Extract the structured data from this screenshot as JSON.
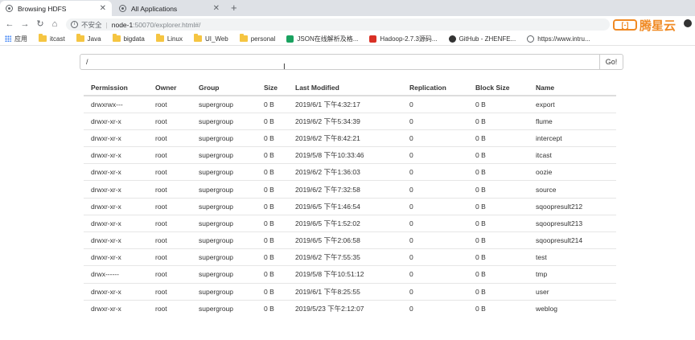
{
  "browser": {
    "tabs": [
      {
        "label": "Browsing HDFS",
        "active": true
      },
      {
        "label": "All Applications",
        "active": false
      }
    ],
    "address": {
      "insecure_label": "不安全",
      "separator": "|",
      "host": "node-1",
      "path": ":50070/explorer.html#/"
    },
    "bookmarks": [
      {
        "label": "应用",
        "icon": "apps-grid-icon"
      },
      {
        "label": "itcast",
        "icon": "folder-icon"
      },
      {
        "label": "Java",
        "icon": "folder-icon"
      },
      {
        "label": "bigdata",
        "icon": "folder-icon"
      },
      {
        "label": "Linux",
        "icon": "folder-icon"
      },
      {
        "label": "UI_Web",
        "icon": "folder-icon"
      },
      {
        "label": "personal",
        "icon": "folder-icon"
      },
      {
        "label": "JSON在线解析及格...",
        "icon": "json-icon"
      },
      {
        "label": "Hadoop-2.7.3源码...",
        "icon": "csdn-icon"
      },
      {
        "label": "GitHub - ZHENFE...",
        "icon": "github-icon"
      },
      {
        "label": "https://www.intru...",
        "icon": "globe-icon"
      }
    ],
    "brand_text": "腾星云"
  },
  "explorer": {
    "path_value": "/",
    "go_label": "Go!",
    "columns": [
      "Permission",
      "Owner",
      "Group",
      "Size",
      "Last Modified",
      "Replication",
      "Block Size",
      "Name"
    ],
    "rows": [
      [
        "drwxrwx---",
        "root",
        "supergroup",
        "0 B",
        "2019/6/1 下午4:32:17",
        "0",
        "0 B",
        "export"
      ],
      [
        "drwxr-xr-x",
        "root",
        "supergroup",
        "0 B",
        "2019/6/2 下午5:34:39",
        "0",
        "0 B",
        "flume"
      ],
      [
        "drwxr-xr-x",
        "root",
        "supergroup",
        "0 B",
        "2019/6/2 下午8:42:21",
        "0",
        "0 B",
        "intercept"
      ],
      [
        "drwxr-xr-x",
        "root",
        "supergroup",
        "0 B",
        "2019/5/8 下午10:33:46",
        "0",
        "0 B",
        "itcast"
      ],
      [
        "drwxr-xr-x",
        "root",
        "supergroup",
        "0 B",
        "2019/6/2 下午1:36:03",
        "0",
        "0 B",
        "oozie"
      ],
      [
        "drwxr-xr-x",
        "root",
        "supergroup",
        "0 B",
        "2019/6/2 下午7:32:58",
        "0",
        "0 B",
        "source"
      ],
      [
        "drwxr-xr-x",
        "root",
        "supergroup",
        "0 B",
        "2019/6/5 下午1:46:54",
        "0",
        "0 B",
        "sqoopresult212"
      ],
      [
        "drwxr-xr-x",
        "root",
        "supergroup",
        "0 B",
        "2019/6/5 下午1:52:02",
        "0",
        "0 B",
        "sqoopresult213"
      ],
      [
        "drwxr-xr-x",
        "root",
        "supergroup",
        "0 B",
        "2019/6/5 下午2:06:58",
        "0",
        "0 B",
        "sqoopresult214"
      ],
      [
        "drwxr-xr-x",
        "root",
        "supergroup",
        "0 B",
        "2019/6/2 下午7:55:35",
        "0",
        "0 B",
        "test"
      ],
      [
        "drwx------",
        "root",
        "supergroup",
        "0 B",
        "2019/5/8 下午10:51:12",
        "0",
        "0 B",
        "tmp"
      ],
      [
        "drwxr-xr-x",
        "root",
        "supergroup",
        "0 B",
        "2019/6/1 下午8:25:55",
        "0",
        "0 B",
        "user"
      ],
      [
        "drwxr-xr-x",
        "root",
        "supergroup",
        "0 B",
        "2019/5/23 下午2:12:07",
        "0",
        "0 B",
        "weblog"
      ]
    ]
  },
  "colors": {
    "link": "#337ab7",
    "brand": "#f08a24",
    "tabstrip": "#dee1e6"
  }
}
